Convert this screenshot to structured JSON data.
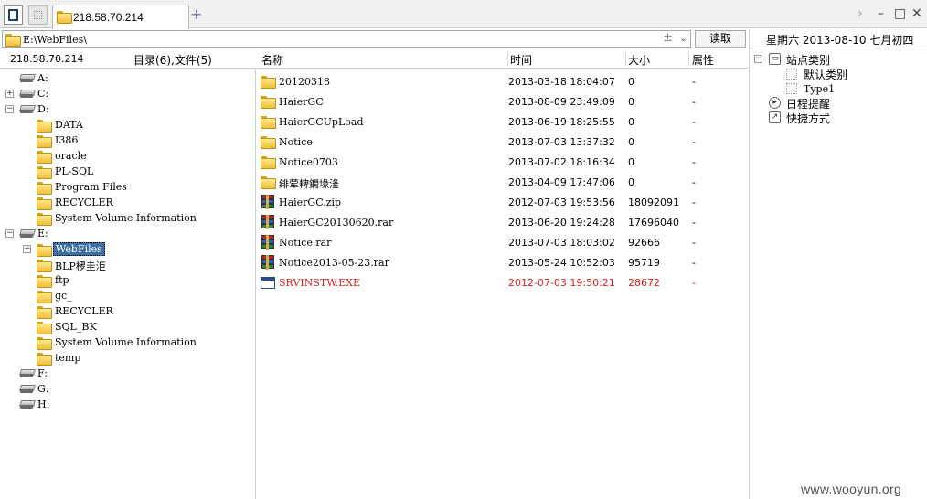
{
  "tabbar": {
    "active_tab": "218.58.70.214",
    "add_tab": "+",
    "controls": {
      "arrow": "›",
      "minimize": "–",
      "maximize": "□",
      "close": "✕"
    }
  },
  "address": {
    "path": "E:\\WebFiles\\",
    "plus": "±",
    "dropdown": "⌄",
    "read_button": "读取"
  },
  "left_panel": {
    "host": "218.58.70.214",
    "summary": "目录(6),文件(5)"
  },
  "tree": {
    "drive_a": "A:",
    "drive_c": "C:",
    "drive_d": "D:",
    "d_children": [
      "DATA",
      "I386",
      "oracle",
      "PL-SQL",
      "Program Files",
      "RECYCLER",
      "System Volume Information"
    ],
    "drive_e": "E:",
    "e_children": [
      "WebFiles",
      "BLP椤圭洰",
      "ftp",
      "gc_",
      "RECYCLER",
      "SQL_BK",
      "System Volume Information",
      "temp"
    ],
    "drive_f": "F:",
    "drive_g": "G:",
    "drive_h": "H:"
  },
  "list": {
    "columns": {
      "name": "名称",
      "time": "时间",
      "size": "大小",
      "attr": "属性"
    },
    "rows": [
      {
        "name": "20120318",
        "time": "2013-03-18 18:04:07",
        "size": "0",
        "attr": "-",
        "icon": "folder-icon"
      },
      {
        "name": "HaierGC",
        "time": "2013-08-09 23:49:09",
        "size": "0",
        "attr": "-",
        "icon": "folder-icon"
      },
      {
        "name": "HaierGCUpLoad",
        "time": "2013-06-19 18:25:55",
        "size": "0",
        "attr": "-",
        "icon": "folder-icon"
      },
      {
        "name": "Notice",
        "time": "2013-07-03 13:37:32",
        "size": "0",
        "attr": "-",
        "icon": "folder-icon"
      },
      {
        "name": "Notice0703",
        "time": "2013-07-02 18:16:34",
        "size": "0",
        "attr": "-",
        "icon": "folder-icon"
      },
      {
        "name": "绯荤粺鐗堟湰",
        "time": "2013-04-09 17:47:06",
        "size": "0",
        "attr": "-",
        "icon": "folder-icon"
      },
      {
        "name": "HaierGC.zip",
        "time": "2012-07-03 19:53:56",
        "size": "18092091",
        "attr": "-",
        "icon": "rar-icon"
      },
      {
        "name": "HaierGC20130620.rar",
        "time": "2013-06-20 19:24:28",
        "size": "17696040",
        "attr": "-",
        "icon": "rar-icon"
      },
      {
        "name": "Notice.rar",
        "time": "2013-07-03 18:03:02",
        "size": "92666",
        "attr": "-",
        "icon": "rar-icon"
      },
      {
        "name": "Notice2013-05-23.rar",
        "time": "2013-05-24 10:52:03",
        "size": "95719",
        "attr": "-",
        "icon": "rar-icon"
      },
      {
        "name": "SRVINSTW.EXE",
        "time": "2012-07-03 19:50:21",
        "size": "28672",
        "attr": "-",
        "icon": "exe-icon"
      }
    ]
  },
  "right_panel": {
    "date": "星期六 2013-08-10 七月初四",
    "site_category": "站点类别",
    "default_category": "默认类别",
    "type1": "Type1",
    "reminder": "日程提醒",
    "shortcut": "快捷方式",
    "collapse_sym": "−"
  },
  "watermark": "www.wooyun.org",
  "colors": {
    "highlight": "#3a6ea5",
    "exe_text": "#e02020",
    "folder": "#f0c03a"
  }
}
